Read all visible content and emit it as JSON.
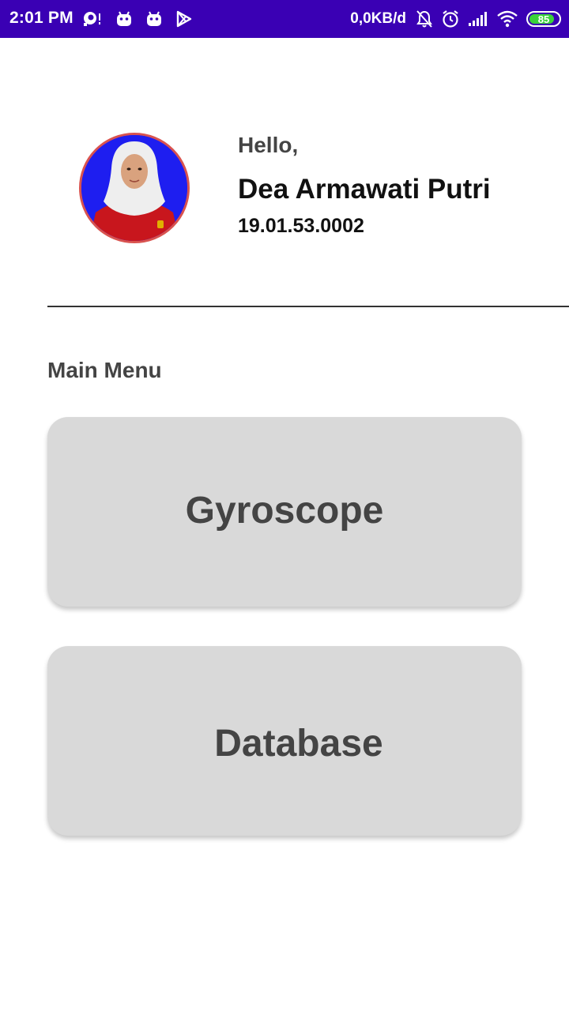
{
  "status_bar": {
    "time": "2:01 PM",
    "left_icons": [
      "notification-app-icon",
      "android-icon",
      "android-icon",
      "play-store-icon"
    ],
    "network_speed": "0,0KB/d",
    "right_icons": [
      "muted-bell-icon",
      "alarm-icon",
      "signal-icon",
      "wifi-icon"
    ],
    "battery_level": "85",
    "battery_fraction": 0.85,
    "background_color": "#3a00b4"
  },
  "profile": {
    "greeting": "Hello,",
    "name": "Dea Armawati Putri",
    "student_id": "19.01.53.0002",
    "avatar_border_color": "#d9534f"
  },
  "main_menu": {
    "title": "Main Menu",
    "items": [
      {
        "label": "Gyroscope"
      },
      {
        "label": "Database"
      }
    ],
    "button_color": "#d9d9d9"
  }
}
